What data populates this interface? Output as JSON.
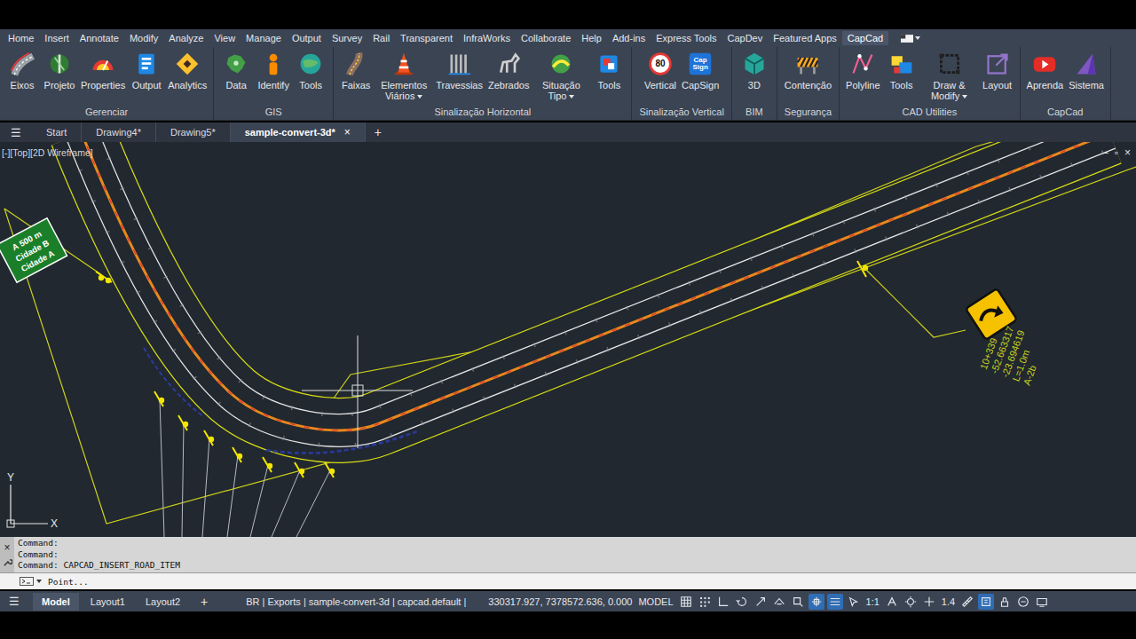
{
  "ribbon": {
    "tabs": [
      {
        "label": "Home",
        "selected": false
      },
      {
        "label": "Insert",
        "selected": false
      },
      {
        "label": "Annotate",
        "selected": false
      },
      {
        "label": "Modify",
        "selected": false
      },
      {
        "label": "Analyze",
        "selected": false
      },
      {
        "label": "View",
        "selected": false
      },
      {
        "label": "Manage",
        "selected": false
      },
      {
        "label": "Output",
        "selected": false
      },
      {
        "label": "Survey",
        "selected": false
      },
      {
        "label": "Rail",
        "selected": false
      },
      {
        "label": "Transparent",
        "selected": false
      },
      {
        "label": "InfraWorks",
        "selected": false
      },
      {
        "label": "Collaborate",
        "selected": false
      },
      {
        "label": "Help",
        "selected": false
      },
      {
        "label": "Add-ins",
        "selected": false
      },
      {
        "label": "Express Tools",
        "selected": false
      },
      {
        "label": "CapDev",
        "selected": false
      },
      {
        "label": "Featured Apps",
        "selected": false
      },
      {
        "label": "CapCad",
        "selected": true
      }
    ],
    "groups": [
      {
        "label": "Gerenciar",
        "buttons": [
          {
            "label": "Eixos",
            "dropdown": false
          },
          {
            "label": "Projeto",
            "dropdown": false
          },
          {
            "label": "Properties",
            "dropdown": false
          },
          {
            "label": "Output",
            "dropdown": false
          },
          {
            "label": "Analytics",
            "dropdown": false
          }
        ]
      },
      {
        "label": "GIS",
        "buttons": [
          {
            "label": "Data",
            "dropdown": false
          },
          {
            "label": "Identify",
            "dropdown": false
          },
          {
            "label": "Tools",
            "dropdown": false
          }
        ]
      },
      {
        "label": "Sinalização Horizontal",
        "buttons": [
          {
            "label": "Faixas",
            "dropdown": false
          },
          {
            "label": "Elementos Viários",
            "dropdown": true
          },
          {
            "label": "Travessias",
            "dropdown": false
          },
          {
            "label": "Zebrados",
            "dropdown": false
          },
          {
            "label": "Situação Tipo",
            "dropdown": true
          },
          {
            "label": "Tools",
            "dropdown": false
          }
        ]
      },
      {
        "label": "Sinalização Vertical",
        "buttons": [
          {
            "label": "Vertical",
            "dropdown": false,
            "badge": "80"
          },
          {
            "label": "CapSign",
            "dropdown": false,
            "badge": "Cap Sign"
          }
        ]
      },
      {
        "label": "BIM",
        "buttons": [
          {
            "label": "3D",
            "dropdown": false
          }
        ]
      },
      {
        "label": "Segurança",
        "buttons": [
          {
            "label": "Contenção",
            "dropdown": false
          }
        ]
      },
      {
        "label": "CAD Utilities",
        "buttons": [
          {
            "label": "Polyline",
            "dropdown": false
          },
          {
            "label": "Tools",
            "dropdown": false
          },
          {
            "label": "Draw & Modify",
            "dropdown": true
          },
          {
            "label": "Layout",
            "dropdown": false
          }
        ]
      },
      {
        "label": "CapCad",
        "buttons": [
          {
            "label": "Aprenda",
            "dropdown": false
          },
          {
            "label": "Sistema",
            "dropdown": false
          }
        ]
      }
    ]
  },
  "file_tabs": {
    "menu": "☰",
    "tabs": [
      {
        "label": "Start",
        "selected": false
      },
      {
        "label": "Drawing4*",
        "selected": false
      },
      {
        "label": "Drawing5*",
        "selected": false
      },
      {
        "label": "sample-convert-3d*",
        "selected": true,
        "close": "×"
      }
    ],
    "add": "+"
  },
  "viewport": {
    "label": "[-][Top][2D Wireframe]",
    "controls": [
      "–",
      "▫",
      "×"
    ]
  },
  "drawing": {
    "direction_sign": [
      "A 500 m",
      "Cidade B",
      "Cidade A"
    ],
    "curve_sign_note": [
      "A-2b",
      "L=1.0m",
      "-23.694619",
      "-52.663317",
      "10+339"
    ],
    "ucs": {
      "x": "X",
      "y": "Y"
    }
  },
  "command_line": {
    "history": [
      "Command:",
      "Command:",
      "Command: CAPCAD_INSERT_ROAD_ITEM"
    ],
    "prompt": "Point...",
    "close": "×"
  },
  "status_bar": {
    "menu": "☰",
    "layout_tabs": [
      {
        "label": "Model",
        "selected": true
      },
      {
        "label": "Layout1",
        "selected": false
      },
      {
        "label": "Layout2",
        "selected": false
      }
    ],
    "add": "+",
    "info": "BR | Exports | sample-convert-3d | capcad.default |",
    "coords": "330317.927, 7378572.636, 0.000",
    "space": "MODEL",
    "toggles_left": [
      {
        "on": false
      },
      {
        "on": false
      },
      {
        "on": false
      },
      {
        "on": false
      },
      {
        "on": false
      },
      {
        "on": false
      },
      {
        "on": false
      },
      {
        "on": true
      },
      {
        "on": true
      },
      {
        "on": false
      }
    ],
    "scale": "1:1",
    "toggles_mid": [
      {
        "on": false
      },
      {
        "on": false
      },
      {
        "on": false
      }
    ],
    "zoom": "1.4",
    "toggles_right": [
      {
        "on": false
      },
      {
        "on": true
      },
      {
        "on": false
      },
      {
        "on": false
      },
      {
        "on": false
      }
    ]
  }
}
